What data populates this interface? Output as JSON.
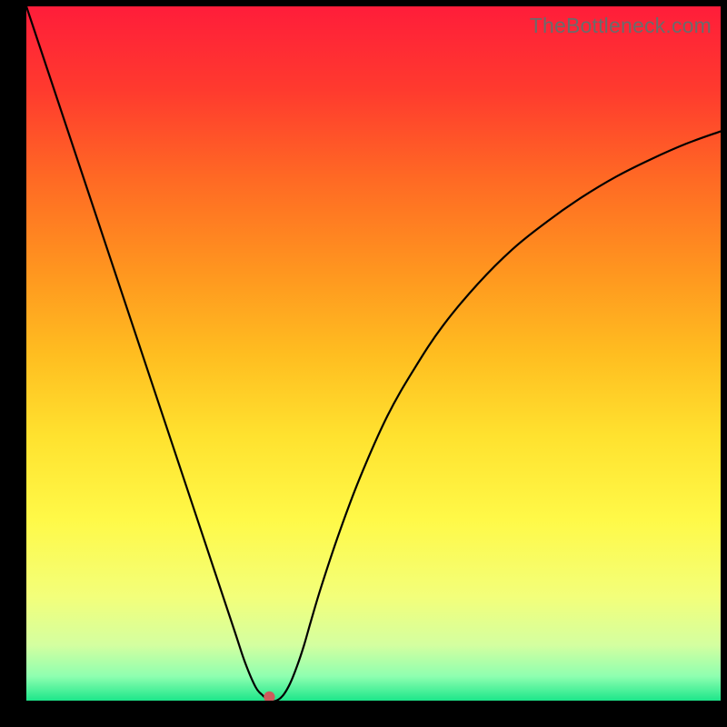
{
  "watermark": "TheBottleneck.com",
  "chart_data": {
    "type": "line",
    "title": "",
    "xlabel": "",
    "ylabel": "",
    "xlim": [
      0,
      100
    ],
    "ylim": [
      0,
      100
    ],
    "marker": {
      "x": 35,
      "y": 0,
      "color": "#cd5c5c"
    },
    "series": [
      {
        "name": "bottleneck-curve",
        "x": [
          0,
          3,
          6,
          9,
          12,
          15,
          18,
          21,
          24,
          27,
          30,
          31.5,
          33,
          34,
          35,
          36,
          37,
          38,
          39,
          40,
          41,
          42.5,
          45,
          48,
          52,
          56,
          60,
          65,
          70,
          75,
          80,
          85,
          90,
          95,
          100
        ],
        "values": [
          100,
          91,
          82,
          73,
          64,
          55,
          46,
          37,
          28,
          19,
          10,
          5.5,
          2.0,
          0.8,
          0.0,
          0.0,
          0.8,
          2.5,
          5.0,
          8.0,
          11.5,
          16.5,
          24,
          32,
          41,
          48,
          54,
          60,
          65,
          69,
          72.5,
          75.5,
          78,
          80.2,
          82
        ]
      }
    ],
    "background_gradient": {
      "stops": [
        {
          "pos": 0.0,
          "color": "#ff1d3a"
        },
        {
          "pos": 0.12,
          "color": "#ff3a2e"
        },
        {
          "pos": 0.25,
          "color": "#ff6a24"
        },
        {
          "pos": 0.38,
          "color": "#ff951f"
        },
        {
          "pos": 0.5,
          "color": "#ffbd20"
        },
        {
          "pos": 0.62,
          "color": "#ffe22f"
        },
        {
          "pos": 0.74,
          "color": "#fff948"
        },
        {
          "pos": 0.85,
          "color": "#f3ff7a"
        },
        {
          "pos": 0.92,
          "color": "#d4ffa0"
        },
        {
          "pos": 0.965,
          "color": "#8effb0"
        },
        {
          "pos": 1.0,
          "color": "#1de68a"
        }
      ]
    }
  }
}
